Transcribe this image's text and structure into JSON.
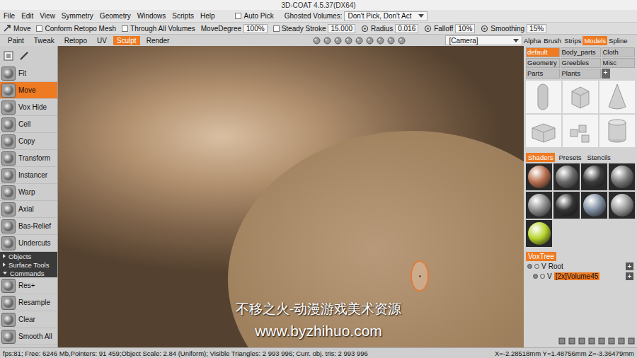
{
  "window": {
    "title": "3D-COAT 4.5.37(DX64)"
  },
  "menu": {
    "items": [
      "File",
      "Edit",
      "View",
      "Symmetry",
      "Geometry",
      "Windows",
      "Scripts",
      "Help"
    ],
    "auto_pick": {
      "label": "Auto Pick",
      "checked": false
    },
    "ghosted": {
      "label": "Ghosted Volumes:",
      "value": "Don't Pick, Don't Act"
    }
  },
  "toolbar": {
    "tool": "Move",
    "options": [
      {
        "kind": "checkbox",
        "label": "Conform Retopo Mesh",
        "checked": false
      },
      {
        "kind": "checkbox",
        "label": "Through All Volumes",
        "checked": false
      },
      {
        "kind": "field",
        "label": "MoveDegree",
        "value": "100%"
      },
      {
        "kind": "check-field",
        "label": "Steady Stroke",
        "checked": false,
        "value": "15.000"
      },
      {
        "kind": "icon-field",
        "label": "Radius",
        "value": "0.016"
      },
      {
        "kind": "icon-field",
        "label": "Falloff",
        "value": "10%"
      },
      {
        "kind": "icon-field",
        "label": "Smoothing",
        "value": "15%"
      }
    ]
  },
  "rooms": [
    {
      "label": "Paint",
      "selected": false
    },
    {
      "label": "Tweak",
      "selected": false
    },
    {
      "label": "Retopo",
      "selected": false
    },
    {
      "label": "UV",
      "selected": false
    },
    {
      "label": "Sculpt",
      "selected": true
    },
    {
      "label": "Render",
      "selected": false
    }
  ],
  "camera": {
    "value": "[Camera]"
  },
  "tools": [
    {
      "label": "Fit",
      "selected": false
    },
    {
      "label": "Move",
      "selected": true
    },
    {
      "label": "Vox Hide",
      "selected": false
    },
    {
      "label": "Cell",
      "selected": false
    },
    {
      "label": "Copy",
      "selected": false
    },
    {
      "label": "Transform",
      "selected": false
    },
    {
      "label": "Instancer",
      "selected": false
    },
    {
      "label": "Warp",
      "selected": false
    },
    {
      "label": "Axial",
      "selected": false
    },
    {
      "label": "Bas-Relief",
      "selected": false
    },
    {
      "label": "Undercuts",
      "selected": false
    }
  ],
  "sections": [
    {
      "label": "Objects",
      "expanded": false
    },
    {
      "label": "Surface Tools",
      "expanded": false
    },
    {
      "label": "Commands",
      "expanded": true
    }
  ],
  "commands": [
    {
      "label": "Res+"
    },
    {
      "label": "Resample"
    },
    {
      "label": "Clear"
    },
    {
      "label": "Smooth All"
    }
  ],
  "panel_tabs": [
    {
      "label": "Alpha",
      "selected": false
    },
    {
      "label": "Brush",
      "selected": false
    },
    {
      "label": "Strips",
      "selected": false
    },
    {
      "label": "Models",
      "selected": true
    },
    {
      "label": "Spline",
      "selected": false
    }
  ],
  "model_sets": {
    "items": [
      {
        "label": "default",
        "selected": true
      },
      {
        "label": "Body_parts",
        "selected": false
      },
      {
        "label": "Cloth",
        "selected": false
      },
      {
        "label": "Geometry",
        "selected": false
      },
      {
        "label": "Greebles",
        "selected": false
      },
      {
        "label": "Misc",
        "selected": false
      },
      {
        "label": "Parts",
        "selected": false
      },
      {
        "label": "Plants",
        "selected": false
      }
    ],
    "add": "+"
  },
  "models": [
    {
      "kind": "capsule"
    },
    {
      "kind": "cube"
    },
    {
      "kind": "cone"
    },
    {
      "kind": "box"
    },
    {
      "kind": "cubes"
    },
    {
      "kind": "cylinder"
    }
  ],
  "shader_tabs": [
    {
      "label": "Shaders",
      "selected": true
    },
    {
      "label": "Presets",
      "selected": false
    },
    {
      "label": "Stencils",
      "selected": false
    }
  ],
  "shaders": [
    {
      "color": "#b9704f"
    },
    {
      "color": "#6a6a6a"
    },
    {
      "color": "#3c3c3c"
    },
    {
      "color": "#7a7a7a"
    },
    {
      "color": "#8e8e8e"
    },
    {
      "color": "#333333"
    },
    {
      "color": "#7f8ea0"
    },
    {
      "color": "#9a9a9a"
    },
    {
      "color": "#b7d42c"
    }
  ],
  "voxtree": {
    "title": "VoxTree",
    "items": [
      {
        "flag": "V",
        "label": "Root",
        "depth": 0,
        "visible": true,
        "selected": false,
        "add": "+"
      },
      {
        "flag": "V",
        "label": "[2x]Volume45",
        "depth": 1,
        "visible": true,
        "selected": true,
        "add": "+"
      }
    ]
  },
  "status": {
    "info": "fps:81; Free: 6246 Mb,Pointers: 91 459;Object Scale: 2.84 (Uniform); Visible Triangles: 2 993 996; Curr. obj. tris: 2 993 996",
    "coords": "X=-2.28518mm Y=1.48756mm Z=-3.36479mm"
  },
  "watermark": {
    "lines": [
      "不移之火-动漫游戏美术资源",
      "www.byzhihuo.com"
    ]
  }
}
